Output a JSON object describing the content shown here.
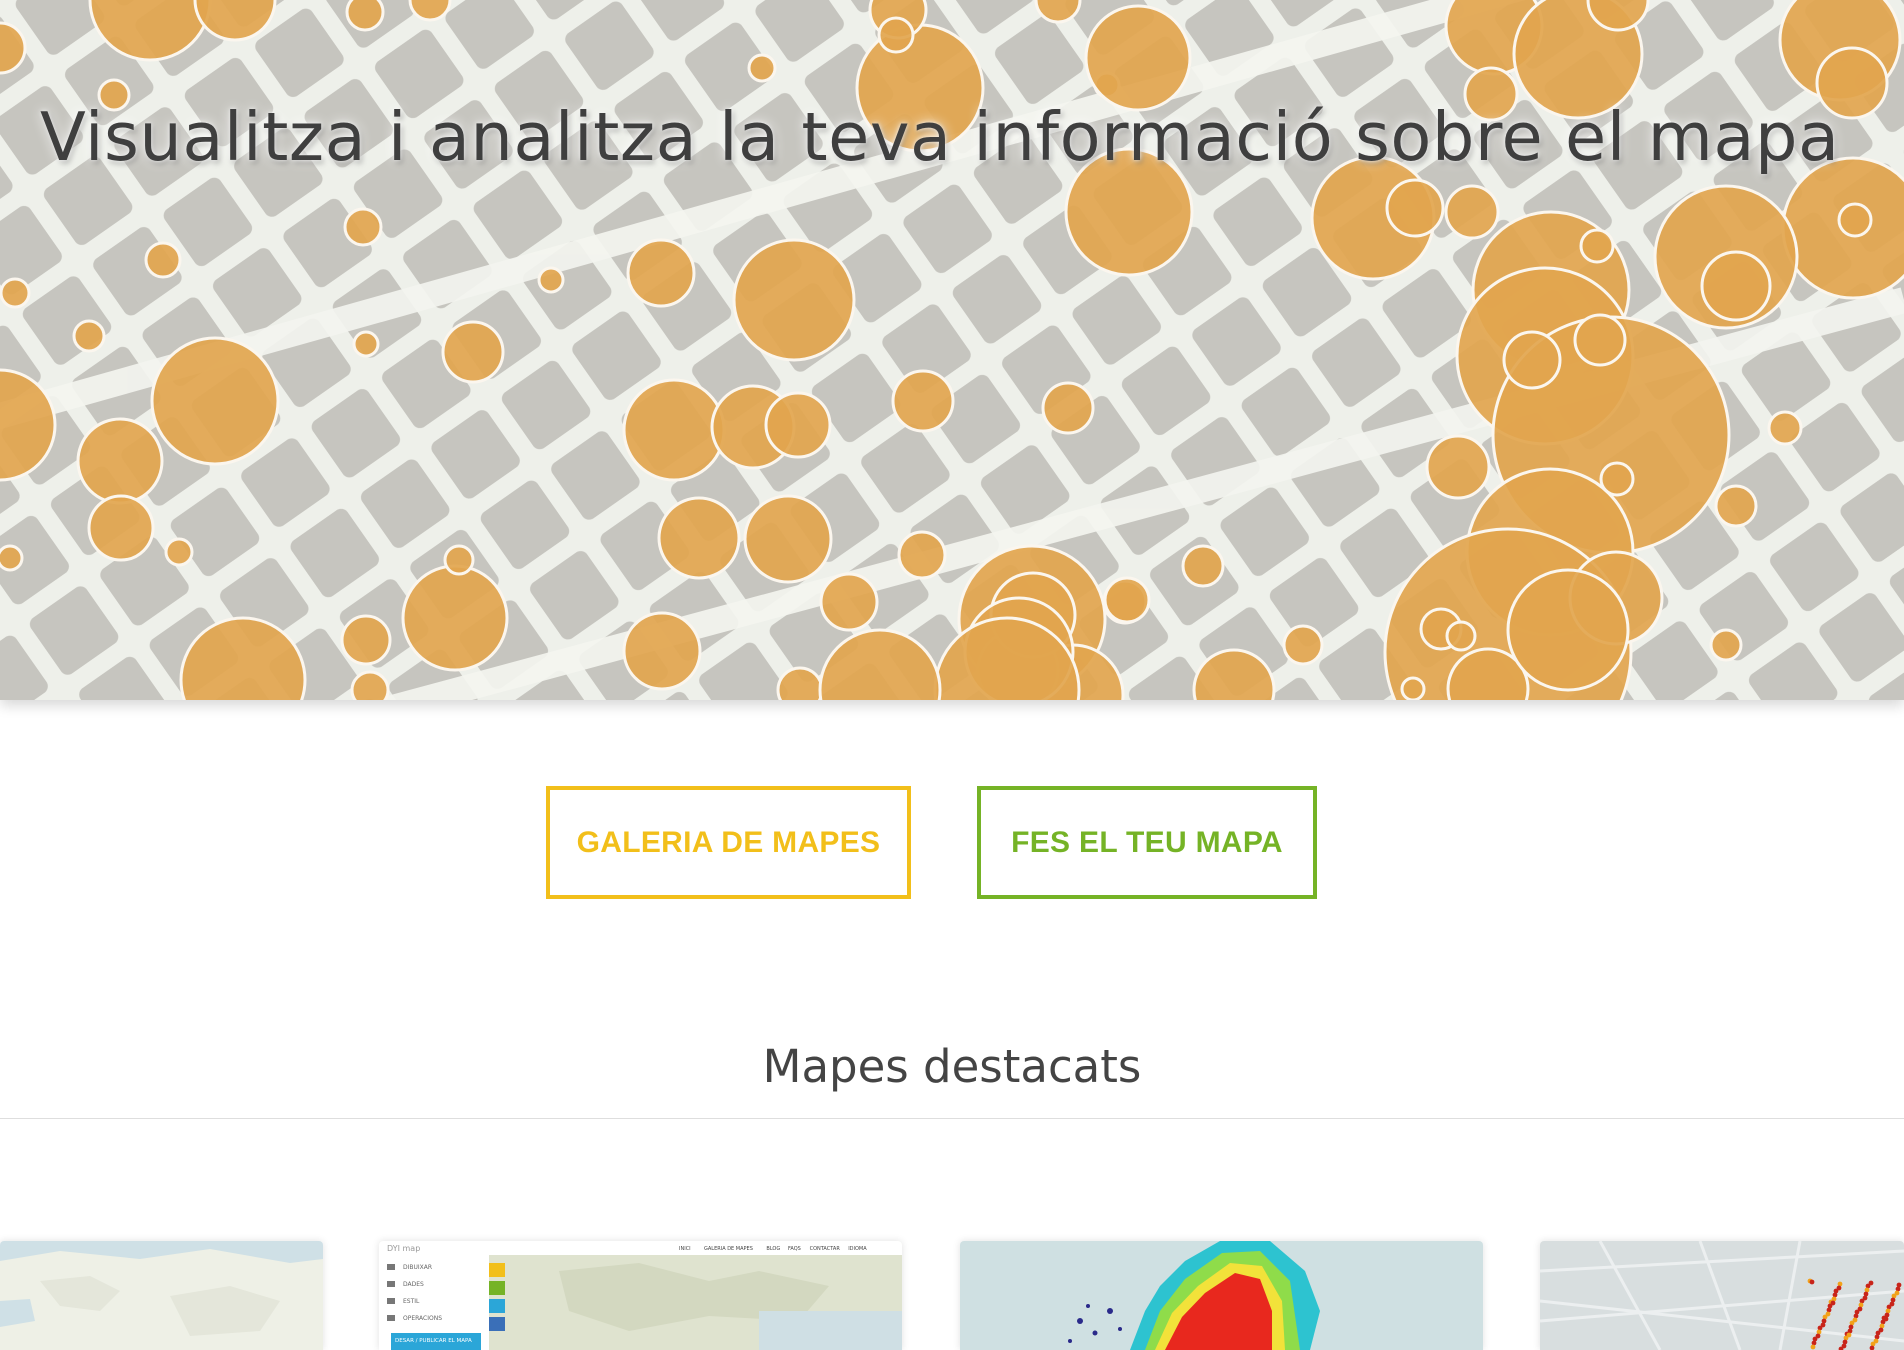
{
  "hero": {
    "title": "Visualitza i analitza la teva informació sobre el mapa",
    "bubble_color": "#e2a54e"
  },
  "actions": {
    "gallery_label": "GALERIA DE MAPES",
    "make_label": "FES EL TEU MAPA",
    "gallery_color": "#f2bf1a",
    "make_color": "#75b326"
  },
  "featured": {
    "title": "Mapes destacats",
    "cards": [
      {
        "name": "featured-map-world"
      },
      {
        "name": "featured-map-editor"
      },
      {
        "name": "featured-map-heatmap"
      },
      {
        "name": "featured-map-points"
      }
    ],
    "editor_preview": {
      "logo": "DYI map",
      "menu": [
        "DIBUIXAR",
        "DADES",
        "ESTIL",
        "OPERACIONS"
      ],
      "publish": "DESAR / PUBLICAR EL MAPA",
      "nav": [
        "INICI",
        "GALERIA DE MAPES",
        "BLOG",
        "FAQS",
        "CONTACTAR",
        "IDIOMA"
      ]
    }
  }
}
